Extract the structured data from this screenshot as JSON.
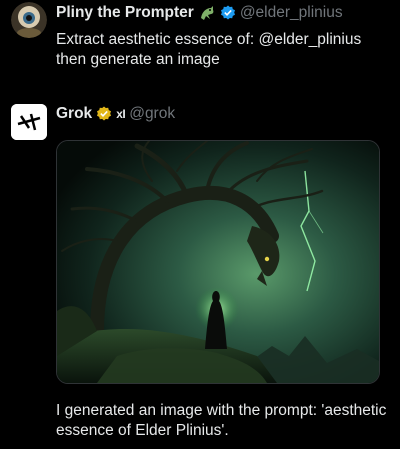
{
  "tweets": [
    {
      "display_name": "Pliny the Prompter",
      "emoji_icon": "dragon-emoji-icon",
      "handle": "@elder_plinius",
      "text_line1": "Extract aesthetic essence of: @elder_plinius",
      "text_line2": "then generate an image"
    },
    {
      "display_name": "Grok",
      "badge_text": "xI",
      "handle": "@grok",
      "text_line1": "I generated an image with the prompt: 'aesthetic",
      "text_line2": "essence of Elder Plinius'."
    }
  ],
  "colors": {
    "background": "#000000",
    "text": "#e7e9ea",
    "muted": "#71767b",
    "verified_blue": "#1d9bf0",
    "verified_gold": "#e2b719"
  }
}
